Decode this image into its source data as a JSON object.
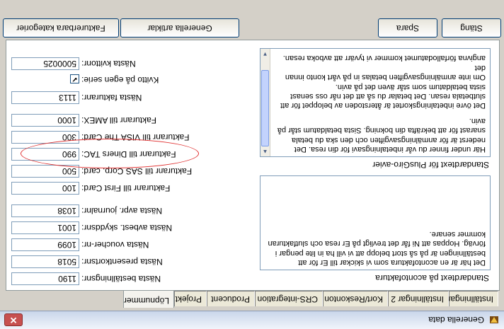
{
  "window": {
    "title": "Generella data",
    "close_label": "✕"
  },
  "tabs": [
    {
      "label": "Inställningar 1"
    },
    {
      "label": "Inställningar 2"
    },
    {
      "label": "Kort/Reskonton"
    },
    {
      "label": "CRS-integration"
    },
    {
      "label": "Producent"
    },
    {
      "label": "Projekt"
    },
    {
      "label": "Löpnummer"
    }
  ],
  "active_tab": "Löpnummer",
  "standard_text_a_conto": {
    "label": "Standardtext på acontofaktura",
    "lines": [
      "Det här är en acontofaktura som vi skickar till Er för att",
      "beställningen är på så stort belopp att vi vill ha in lite pengar i",
      "förväg. Hoppas att Ni får det trevligt på Er resa och slutfakturan",
      "kommer senare."
    ]
  },
  "standard_text_plusgiro": {
    "label": "Standardtext för PlusGiro-avier",
    "lines": [
      "Här under finner du vår inbetalningsavi för din resa. Det",
      "nederst är för anmälningsavgiften och den ska du betala",
      "snarast för att bekräfta din bokning. Sista betaldatum står på",
      "avin.",
      "Det övre inbetalningskortet är återstoden av beloppet för att",
      "slutbetala resan. Det betalar du så att det når oss senast",
      "sista betaldatum som står även det på avin.",
      "Om inte anmälningsavgiften betalas in på vårt konto innan det",
      "angivna förfallodatumet kommer vi tyvärr att avboka resan."
    ]
  },
  "fields": [
    {
      "label": "Nästa beställningsnr:",
      "value": "1190"
    },
    {
      "label": "Nästa presentkortsnr:",
      "value": "5018"
    },
    {
      "label": "Nästa voucher-nr:",
      "value": "1099"
    },
    {
      "label": "Nästa avbest. skyddsnr:",
      "value": "1001"
    },
    {
      "label": "Nästa avpr. journalnr:",
      "value": "1038"
    },
    {
      "label": "Fakturanr till First Card:",
      "value": "100"
    },
    {
      "label": "Fakturanr till SAS Corp. card:",
      "value": "500"
    },
    {
      "label": "Fakturanr till Diners TAC:",
      "value": "990"
    },
    {
      "label": "Fakturanr till VISA The Card:",
      "value": "300"
    },
    {
      "label": "Fakturanr till AMEX:",
      "value": "1000"
    },
    {
      "label": "Nästa fakturanr:",
      "value": "1113"
    }
  ],
  "kvitto_checkbox": {
    "label": "Kvitto på egen serie:",
    "checked": true,
    "mark": "✔"
  },
  "kvitto_number": {
    "label": "Nästa kvittonr:",
    "value": "5000025"
  },
  "buttons": {
    "fakturerbara": "Fakturerbara kategorier",
    "generella": "Generella artiklar",
    "save": "Spara",
    "close": "Stäng"
  }
}
